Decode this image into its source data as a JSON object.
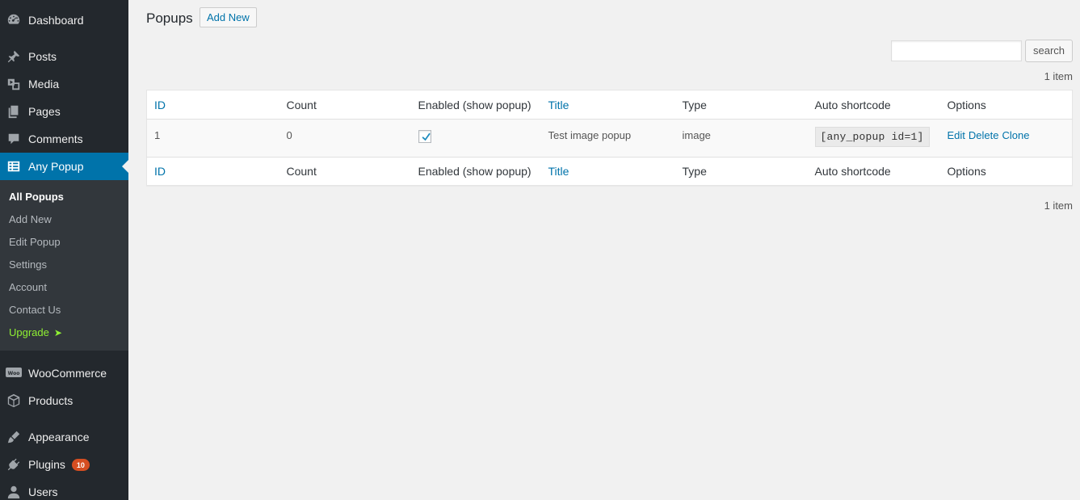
{
  "sidebar": {
    "top_items": [
      {
        "label": "Dashboard",
        "icon": "dashboard-icon"
      },
      {
        "label": "Posts",
        "icon": "pushpin-icon"
      },
      {
        "label": "Media",
        "icon": "media-icon"
      },
      {
        "label": "Pages",
        "icon": "pages-icon"
      },
      {
        "label": "Comments",
        "icon": "comment-icon"
      },
      {
        "label": "Any Popup",
        "icon": "table-icon"
      },
      {
        "label": "WooCommerce",
        "icon": "woo-icon"
      },
      {
        "label": "Products",
        "icon": "box-icon"
      },
      {
        "label": "Appearance",
        "icon": "paintbrush-icon"
      },
      {
        "label": "Plugins",
        "icon": "plug-icon",
        "badge": "10"
      },
      {
        "label": "Users",
        "icon": "user-icon"
      }
    ],
    "submenu": [
      {
        "label": "All Popups"
      },
      {
        "label": "Add New"
      },
      {
        "label": "Edit Popup"
      },
      {
        "label": "Settings"
      },
      {
        "label": "Account"
      },
      {
        "label": "Contact Us"
      },
      {
        "label": "Upgrade"
      }
    ]
  },
  "header": {
    "title": "Popups",
    "add_new": "Add New"
  },
  "search": {
    "value": "",
    "button": "search"
  },
  "pagination": {
    "top_count": "1 item",
    "bottom_count": "1 item"
  },
  "table": {
    "columns": [
      "ID",
      "Count",
      "Enabled (show popup)",
      "Title",
      "Type",
      "Auto shortcode",
      "Options"
    ],
    "rows": [
      {
        "id": "1",
        "count": "0",
        "enabled": true,
        "title": "Test image popup",
        "type": "image",
        "shortcode": "[any_popup id=1]",
        "options": [
          "Edit",
          "Delete",
          "Clone"
        ]
      }
    ]
  },
  "colors": {
    "sidebar_bg": "#23282d",
    "submenu_bg": "#32373c",
    "accent": "#0073aa",
    "upgrade": "#8ff033",
    "badge": "#d54e21"
  }
}
